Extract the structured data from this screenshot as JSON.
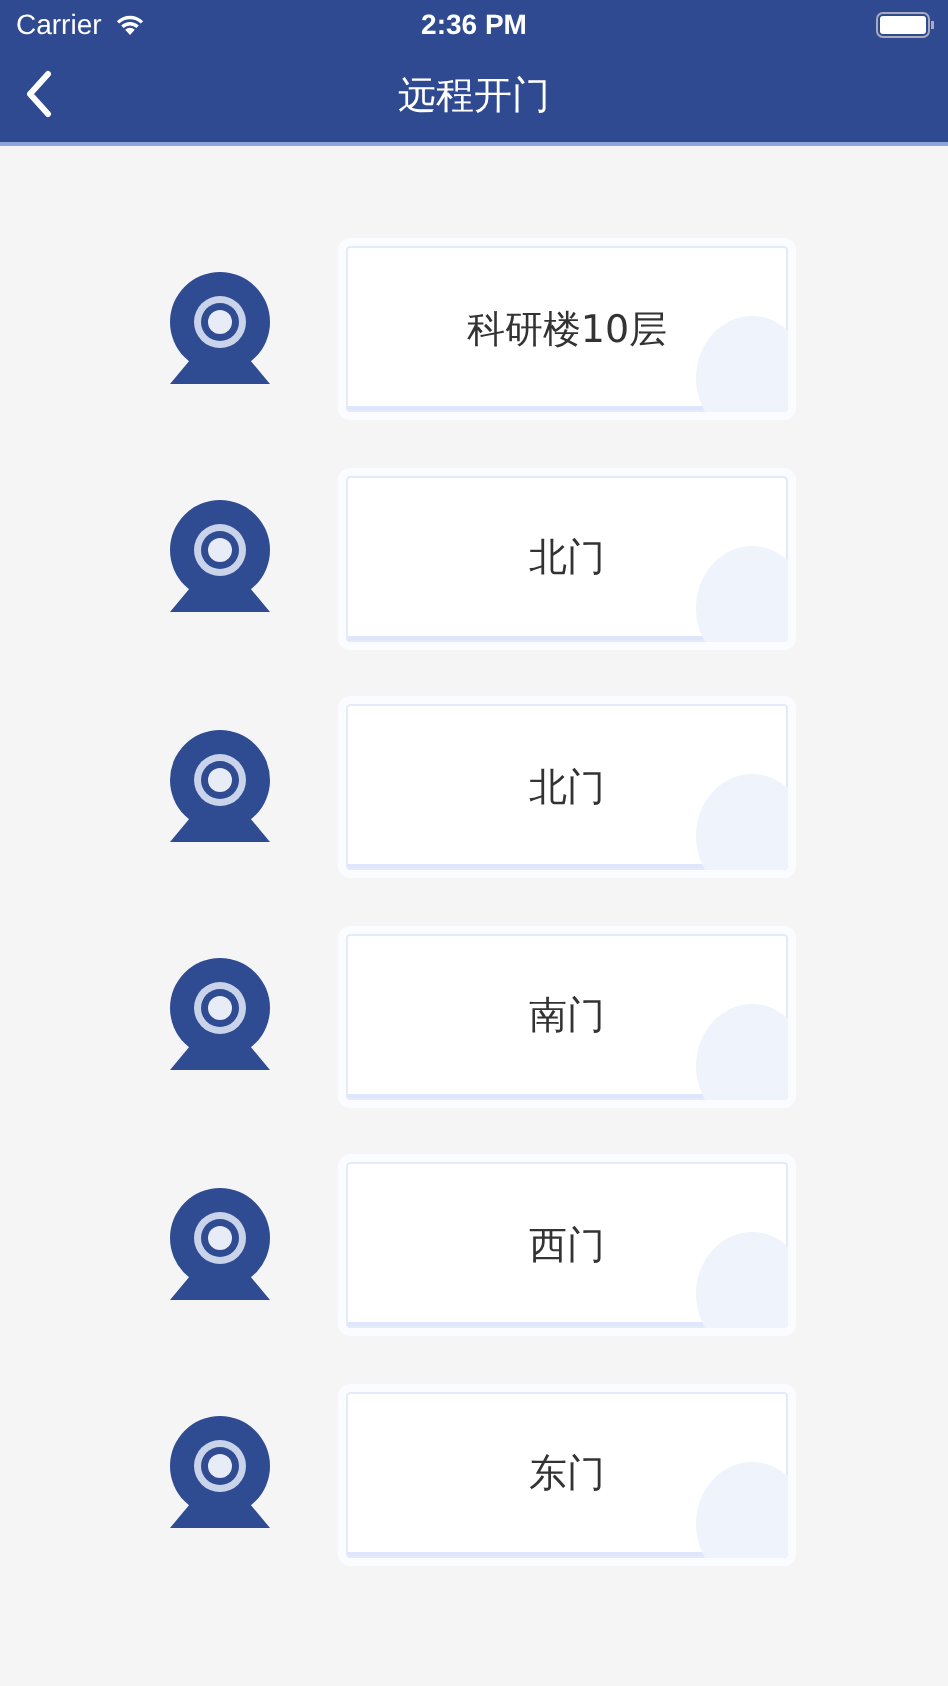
{
  "status_bar": {
    "carrier": "Carrier",
    "time": "2:36 PM"
  },
  "nav": {
    "title": "远程开门"
  },
  "doors": [
    {
      "name": "科研楼10层"
    },
    {
      "name": "北门"
    },
    {
      "name": "北门"
    },
    {
      "name": "南门"
    },
    {
      "name": "西门"
    },
    {
      "name": "东门"
    }
  ]
}
